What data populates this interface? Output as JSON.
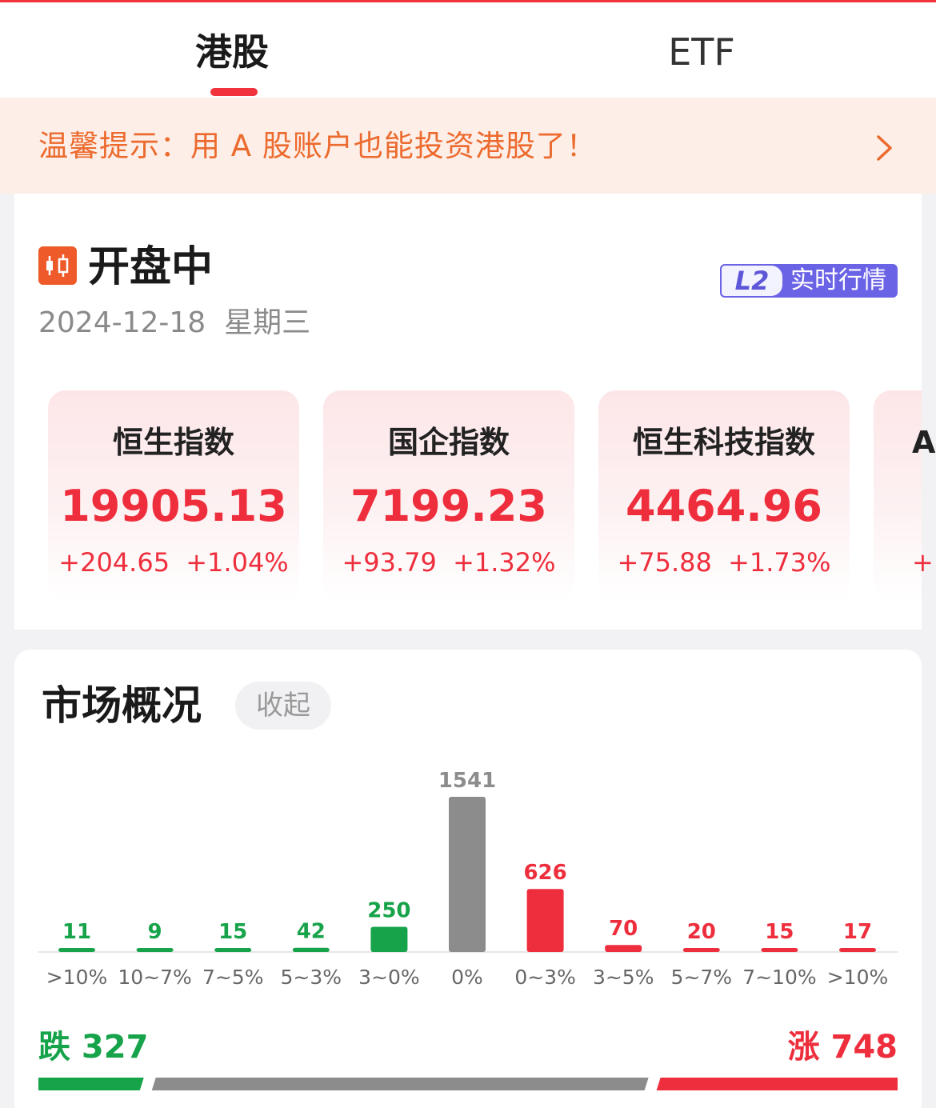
{
  "colors": {
    "accent_red": "#ee2e3c",
    "fall_green": "#17a34a",
    "flat_gray": "#8c8c8c",
    "notice_orange": "#ec6a2d",
    "l2_purple": "#6b63e6"
  },
  "tabs": [
    {
      "label": "港股",
      "active": true
    },
    {
      "label": "ETF",
      "active": false
    }
  ],
  "notice": {
    "text": "温馨提示：用 A 股账户也能投资港股了！",
    "icon": "chevron-right-icon"
  },
  "market_status": {
    "icon": "candlestick-icon",
    "title": "开盘中",
    "date": "2024-12-18  星期三",
    "badge_l2": "L2",
    "badge_text": "实时行情"
  },
  "indices": [
    {
      "name": "恒生指数",
      "value": "19905.13",
      "change": "+204.65",
      "percent": "+1.04%"
    },
    {
      "name": "国企指数",
      "value": "7199.23",
      "change": "+93.79",
      "percent": "+1.32%"
    },
    {
      "name": "恒生科技指数",
      "value": "4464.96",
      "change": "+75.88",
      "percent": "+1.73%"
    },
    {
      "name": "A",
      "value": "",
      "change": "+",
      "percent": ""
    }
  ],
  "overview": {
    "title": "市场概况",
    "collapse_label": "收起",
    "fall_label": "跌 327",
    "rise_label": "涨 748"
  },
  "chart_data": {
    "type": "bar",
    "categories": [
      ">10%",
      "10~7%",
      "7~5%",
      "5~3%",
      "3~0%",
      "0%",
      "0~3%",
      "3~5%",
      "5~7%",
      "7~10%",
      ">10%"
    ],
    "values": [
      11,
      9,
      15,
      42,
      250,
      1541,
      626,
      70,
      20,
      15,
      17
    ],
    "bar_colors": [
      "green",
      "green",
      "green",
      "green",
      "green",
      "gray",
      "red",
      "red",
      "red",
      "red",
      "red"
    ],
    "summary": {
      "fall": 327,
      "flat": 1541,
      "rise": 748
    }
  }
}
